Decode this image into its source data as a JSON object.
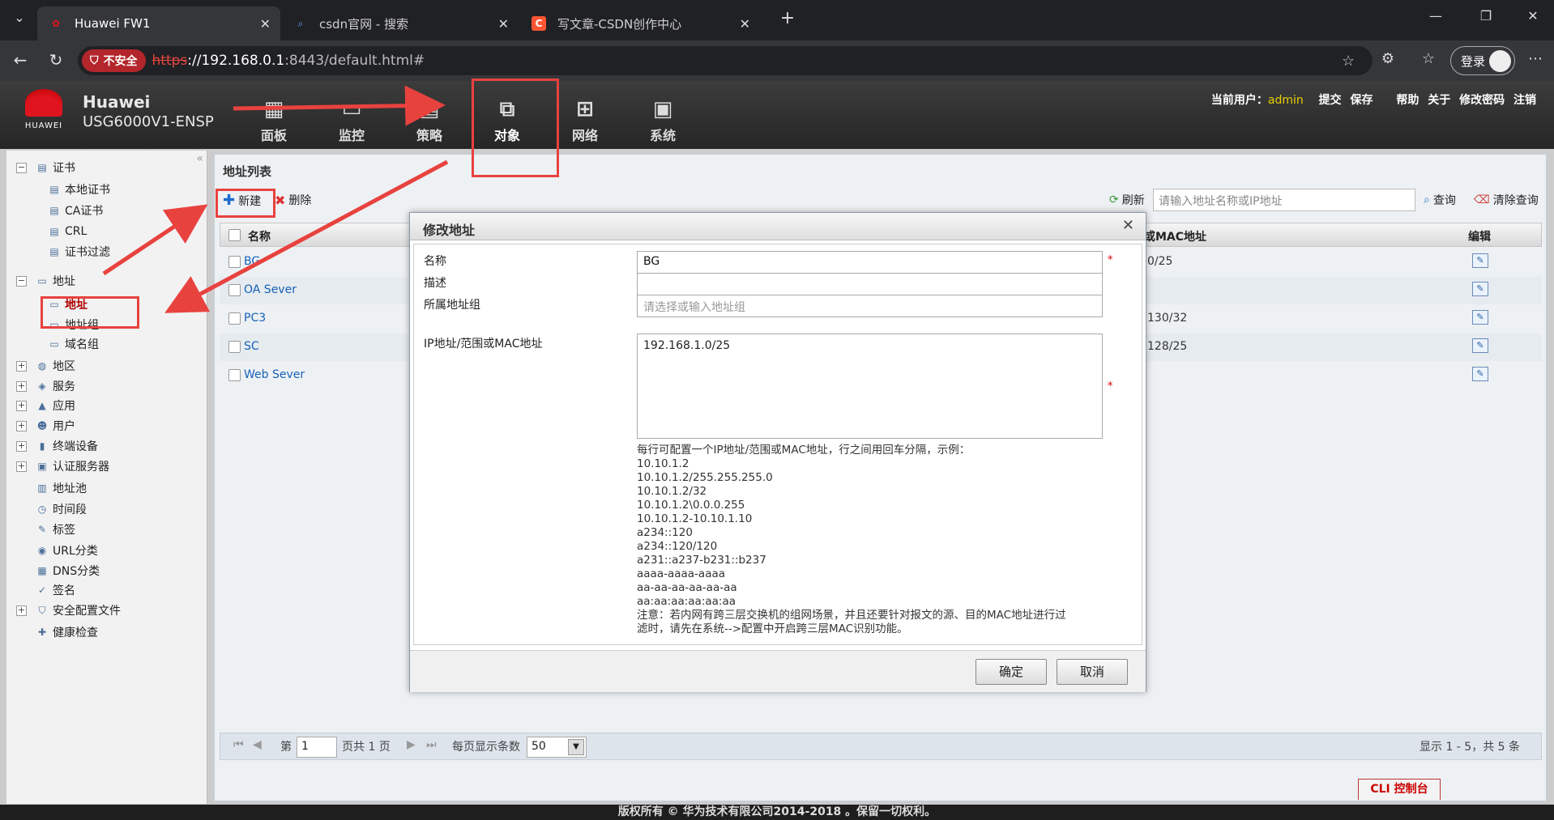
{
  "browser": {
    "tabs": [
      {
        "title": "Huawei FW1",
        "icon": "huawei-logo-icon"
      },
      {
        "title": "csdn官网 - 搜索",
        "icon": "search-icon"
      },
      {
        "title": "写文章-CSDN创作中心",
        "icon": "csdn-logo-icon"
      }
    ],
    "security_label": "不安全",
    "url_scheme": "https",
    "url_host": "://192.168.0.1",
    "url_rest": ":8443/default.html#",
    "login_label": "登录"
  },
  "app": {
    "brand_logo_text": "HUAWEI",
    "brand_name": "Huawei",
    "model": "USG6000V1-ENSP",
    "nav": [
      {
        "label": "面板",
        "icon": "dashboard-icon"
      },
      {
        "label": "监控",
        "icon": "monitor-icon"
      },
      {
        "label": "策略",
        "icon": "policy-icon"
      },
      {
        "label": "对象",
        "icon": "object-icon",
        "selected": true
      },
      {
        "label": "网络",
        "icon": "network-icon"
      },
      {
        "label": "系统",
        "icon": "system-icon"
      }
    ],
    "current_user_label": "当前用户：",
    "current_user": "admin",
    "top_links": [
      "提交",
      "保存",
      "帮助",
      "关于",
      "修改密码",
      "注销"
    ]
  },
  "tree": [
    {
      "label": "证书",
      "level": 0,
      "expand": "minus",
      "icon": "certificate-icon"
    },
    {
      "label": "本地证书",
      "level": 1,
      "icon": "local-cert-icon"
    },
    {
      "label": "CA证书",
      "level": 1,
      "icon": "ca-cert-icon"
    },
    {
      "label": "CRL",
      "level": 1,
      "icon": "crl-icon"
    },
    {
      "label": "证书过滤",
      "level": 1,
      "icon": "cert-filter-icon"
    },
    {
      "label": "地址",
      "level": 0,
      "expand": "minus",
      "icon": "address-icon"
    },
    {
      "label": "地址",
      "level": 1,
      "icon": "address-item-icon",
      "active": true
    },
    {
      "label": "地址组",
      "level": 1,
      "icon": "address-group-icon"
    },
    {
      "label": "域名组",
      "level": 1,
      "icon": "domain-group-icon"
    },
    {
      "label": "地区",
      "level": 0,
      "expand": "plus",
      "icon": "region-icon"
    },
    {
      "label": "服务",
      "level": 0,
      "expand": "plus",
      "icon": "service-icon"
    },
    {
      "label": "应用",
      "level": 0,
      "expand": "plus",
      "icon": "application-icon"
    },
    {
      "label": "用户",
      "level": 0,
      "expand": "plus",
      "icon": "user-icon"
    },
    {
      "label": "终端设备",
      "level": 0,
      "expand": "plus",
      "icon": "terminal-icon"
    },
    {
      "label": "认证服务器",
      "level": 0,
      "expand": "plus",
      "icon": "auth-server-icon"
    },
    {
      "label": "地址池",
      "level": 0,
      "icon": "address-pool-icon"
    },
    {
      "label": "时间段",
      "level": 0,
      "icon": "time-range-icon"
    },
    {
      "label": "标签",
      "level": 0,
      "icon": "tag-icon"
    },
    {
      "label": "URL分类",
      "level": 0,
      "icon": "url-category-icon"
    },
    {
      "label": "DNS分类",
      "level": 0,
      "icon": "dns-category-icon"
    },
    {
      "label": "签名",
      "level": 0,
      "icon": "signature-icon"
    },
    {
      "label": "安全配置文件",
      "level": 0,
      "expand": "plus",
      "icon": "security-profile-icon"
    },
    {
      "label": "健康检查",
      "level": 0,
      "icon": "health-check-icon"
    }
  ],
  "list": {
    "title": "地址列表",
    "new_label": "新建",
    "delete_label": "删除",
    "refresh_label": "刷新",
    "search_placeholder": "请输入地址名称或IP地址",
    "query_label": "查询",
    "clear_label": "清除查询",
    "col_name": "名称",
    "col_addr": "或MAC地址",
    "col_edit": "编辑",
    "rows": [
      {
        "name": "BG",
        "addr": "0/25"
      },
      {
        "name": "OA Sever",
        "addr": ""
      },
      {
        "name": "PC3",
        "addr": "130/32"
      },
      {
        "name": "SC",
        "addr": "128/25"
      },
      {
        "name": "Web Sever",
        "addr": ""
      }
    ]
  },
  "pager": {
    "page_prefix": "第",
    "page_value": "1",
    "page_suffix": "页共 1 页",
    "per_page_label": "每页显示条数",
    "per_page_value": "50",
    "summary": "显示 1 - 5，共 5 条"
  },
  "dialog": {
    "title": "修改地址",
    "name_label": "名称",
    "name_value": "BG",
    "desc_label": "描述",
    "group_label": "所属地址组",
    "group_placeholder": "请选择或输入地址组",
    "ip_label": "IP地址/范围或MAC地址",
    "ip_value": "192.168.1.0/25",
    "hint_lines": [
      "每行可配置一个IP地址/范围或MAC地址，行之间用回车分隔，示例：",
      "10.10.1.2",
      "10.10.1.2/255.255.255.0",
      "10.10.1.2/32",
      "10.10.1.2\\0.0.0.255",
      "10.10.1.2-10.10.1.10",
      "a234::120",
      "a234::120/120",
      "a231::a237-b231::b237",
      "aaaa-aaaa-aaaa",
      "aa-aa-aa-aa-aa-aa",
      "aa:aa:aa:aa:aa:aa",
      "注意：若内网有跨三层交换机的组网场景，并且还要针对报文的源、目的MAC地址进行过",
      "滤时，请先在系统-->配置中开启跨三层MAC识别功能。"
    ],
    "ok_label": "确定",
    "cancel_label": "取消"
  },
  "cli_label": "CLI 控制台",
  "footer": "版权所有 © 华为技术有限公司2014-2018 。保留一切权利。",
  "colors": {
    "accent": "#e8423f",
    "link": "#1561b8",
    "user": "#e8d000"
  }
}
